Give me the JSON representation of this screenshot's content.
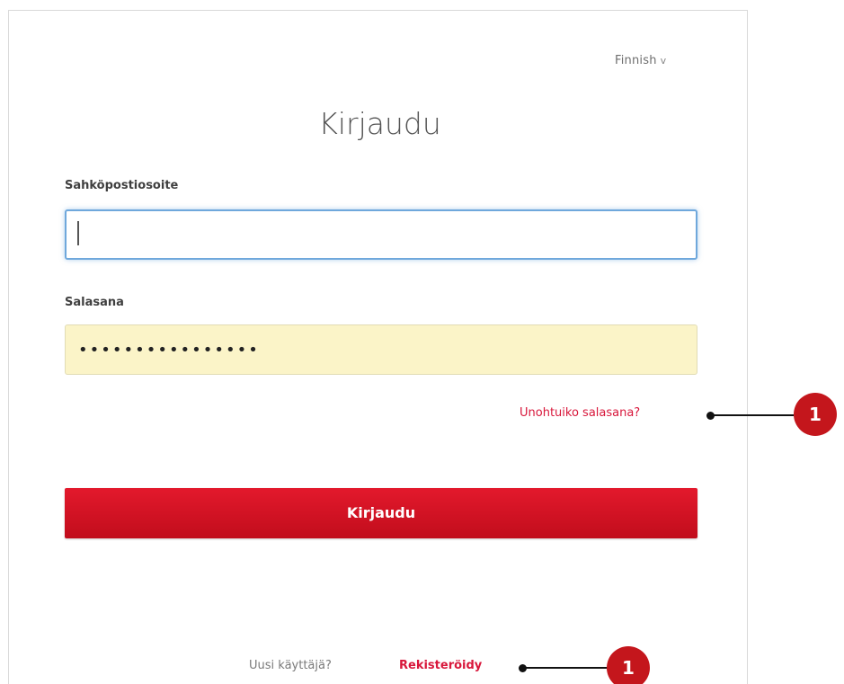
{
  "language": {
    "label": "Finnish",
    "chevron": "v"
  },
  "form": {
    "title": "Kirjaudu",
    "email_label": "Sahköpostiosoite",
    "email_value": "",
    "password_label": "Salasana",
    "password_value": "••••••••••••••••",
    "forgot_link": "Unohtuiko salasana?",
    "submit_label": "Kirjaudu"
  },
  "footer": {
    "new_user_text": "Uusi käyttäjä?",
    "register_link": "Rekisteröidy"
  },
  "callouts": [
    {
      "number": "1",
      "target": "forgot-password-link"
    },
    {
      "number": "1",
      "target": "register-link"
    }
  ],
  "colors": {
    "accent_red": "#c4161c",
    "link_red": "#d8173b",
    "focus_blue": "#6fa8dc",
    "autofill_yellow": "#fbf4c8"
  }
}
